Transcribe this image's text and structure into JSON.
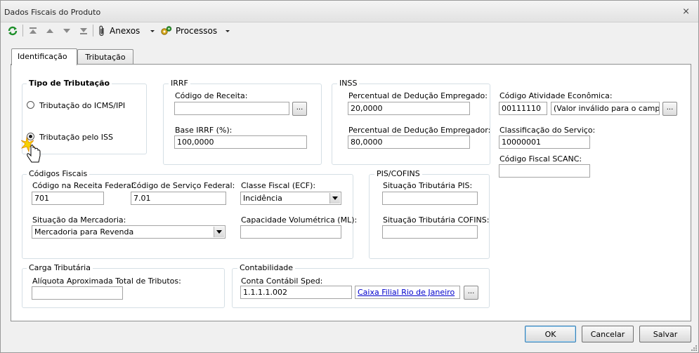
{
  "window": {
    "title": "Dados Fiscais do Produto",
    "close_glyph": "⨯"
  },
  "toolbar": {
    "icons": [
      "refresh-icon",
      "first-record-icon",
      "previous-record-icon",
      "next-record-icon",
      "last-record-icon"
    ],
    "anexos_label": "Anexos",
    "processos_label": "Processos"
  },
  "tabs": [
    {
      "label": "Identificação",
      "active": true
    },
    {
      "label": "Tributação",
      "active": false
    }
  ],
  "tipo_tributacao": {
    "title": "Tipo de Tributação",
    "options": [
      {
        "label": "Tributação do ICMS/IPI",
        "checked": false
      },
      {
        "label": "Tributação pelo ISS",
        "checked": true
      }
    ]
  },
  "irrf": {
    "title": "IRRF",
    "codigo_receita_label": "Código de Receita:",
    "codigo_receita_value": "",
    "base_label": "Base IRRF (%):",
    "base_value": "100,0000",
    "lookup": "..."
  },
  "inss": {
    "title": "INSS",
    "empregado_label": "Percentual de Dedução Empregado:",
    "empregado_value": "20,0000",
    "empregador_label": "Percentual de Dedução Empregador:",
    "empregador_value": "80,0000"
  },
  "atividade": {
    "codigo_label": "Código Atividade Econômica:",
    "codigo_value": "00111110",
    "descricao_value": "(Valor inválido para o campo de",
    "lookup": "...",
    "classificacao_label": "Classificação do Serviço:",
    "classificacao_value": "10000001",
    "scanc_label": "Código Fiscal SCANC:",
    "scanc_value": ""
  },
  "codigos_fiscais": {
    "title": "Códigos Fiscais",
    "receita_federal_label": "Código na Receita Federal:",
    "receita_federal_value": "701",
    "servico_federal_label": "Código de Serviço Federal:",
    "servico_federal_value": "7.01",
    "classe_fiscal_label": "Classe Fiscal (ECF):",
    "classe_fiscal_value": "Incidência",
    "situacao_label": "Situação da Mercadoria:",
    "situacao_value": "Mercadoria para Revenda",
    "capacidade_label": "Capacidade Volumétrica (ML):",
    "capacidade_value": ""
  },
  "pis_cofins": {
    "title": "PIS/COFINS",
    "pis_label": "Situação Tributária PIS:",
    "pis_value": "",
    "cofins_label": "Situação Tributária COFINS:",
    "cofins_value": ""
  },
  "carga": {
    "title": "Carga Tributária",
    "aliquota_label": "Alíquota Aproximada Total de Tributos:",
    "aliquota_value": ""
  },
  "contabilidade": {
    "title": "Contabilidade",
    "conta_label": "Conta Contábil Sped:",
    "conta_value": "1.1.1.1.002",
    "conta_link": "Caixa Filial Rio de Janeiro",
    "lookup": "..."
  },
  "buttons": {
    "ok": "OK",
    "cancelar": "Cancelar",
    "salvar": "Salvar"
  }
}
